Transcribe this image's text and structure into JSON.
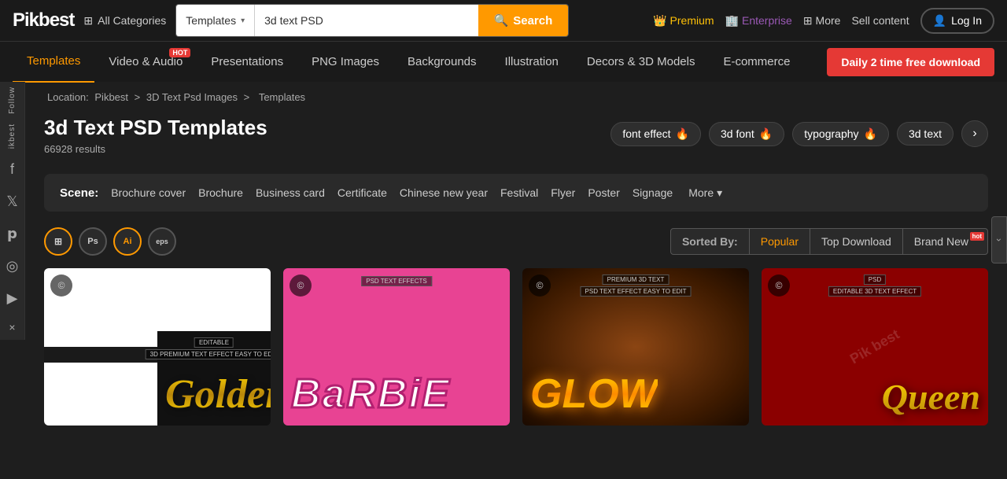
{
  "brand": {
    "name_part1": "Pik",
    "name_part2": "best"
  },
  "top_nav": {
    "all_categories": "All Categories",
    "search_dropdown": "Templates",
    "search_placeholder": "3d text PSD",
    "search_btn": "Search",
    "premium": "Premium",
    "enterprise": "Enterprise",
    "more": "More",
    "sell": "Sell content",
    "login": "Log In"
  },
  "second_nav": {
    "daily_btn": "Daily 2 time free download",
    "items": [
      {
        "label": "Templates",
        "active": true,
        "hot": false
      },
      {
        "label": "Video & Audio",
        "active": false,
        "hot": true
      },
      {
        "label": "Presentations",
        "active": false,
        "hot": false
      },
      {
        "label": "PNG Images",
        "active": false,
        "hot": false
      },
      {
        "label": "Backgrounds",
        "active": false,
        "hot": false
      },
      {
        "label": "Illustration",
        "active": false,
        "hot": false
      },
      {
        "label": "Decors & 3D Models",
        "active": false,
        "hot": false
      },
      {
        "label": "E-commerce",
        "active": false,
        "hot": false
      }
    ]
  },
  "breadcrumb": {
    "location": "Location:",
    "items": [
      "Pikbest",
      "3D Text Psd Images",
      "Templates"
    ]
  },
  "page_title": "3d Text PSD Templates",
  "results": "66928  results",
  "tags": [
    {
      "label": "font effect",
      "flame": "🔥"
    },
    {
      "label": "3d font",
      "flame": "🔥"
    },
    {
      "label": "typography",
      "flame": "🔥"
    },
    {
      "label": "3d text"
    }
  ],
  "scene": {
    "label": "Scene:",
    "items": [
      "Brochure cover",
      "Brochure",
      "Business card",
      "Certificate",
      "Chinese new year",
      "Festival",
      "Flyer",
      "Poster",
      "Signage"
    ],
    "more": "More"
  },
  "formats": [
    {
      "icon": "⊞",
      "label": "all"
    },
    {
      "icon": "Ps",
      "label": "photoshop"
    },
    {
      "icon": "Ai",
      "label": "illustrator"
    },
    {
      "icon": "eps",
      "label": "eps"
    }
  ],
  "sort": {
    "label": "Sorted By:",
    "items": [
      {
        "label": "Popular",
        "active": true,
        "hot": false
      },
      {
        "label": "Top Download",
        "active": false,
        "hot": false
      },
      {
        "label": "Brand New",
        "active": false,
        "hot": true
      }
    ]
  },
  "cards": [
    {
      "id": 1,
      "text": "Golden",
      "type": "golden",
      "copyright": "©",
      "badge1": "EDITABLE",
      "badge2": "3D PREMIUM TEXT EFFECT"
    },
    {
      "id": 2,
      "text": "BaRBiE",
      "type": "barbie",
      "copyright": "©",
      "badge1": "PSD TEXT EFFECTS"
    },
    {
      "id": 3,
      "text": "GLOW",
      "type": "glow",
      "copyright": "©",
      "badge1": "PREMIUM 3D TEXT",
      "badge2": "PSD TEXT EFFECT EASY TO EDIT"
    },
    {
      "id": 4,
      "text": "Queen",
      "type": "queen",
      "copyright": "©",
      "badge1": "PSD",
      "badge2": "EDITABLE 3D TEXT EFFECT"
    }
  ],
  "sidebar": {
    "follow_label": "Follow",
    "brand_label": "ikbest",
    "icons": [
      "f",
      "t",
      "p",
      "ig",
      "yt"
    ],
    "close": "×"
  }
}
